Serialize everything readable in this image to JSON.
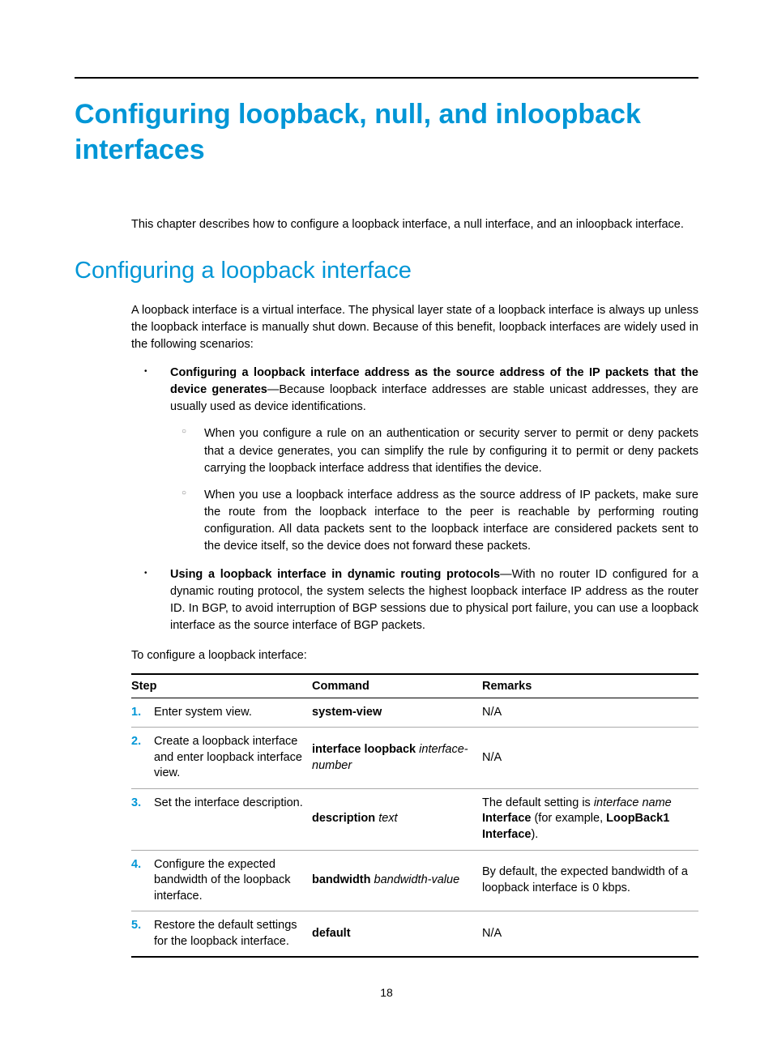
{
  "h1": "Configuring loopback, null, and inloopback interfaces",
  "intro": "This chapter describes how to configure a loopback interface, a null interface, and an inloopback interface.",
  "h2": "Configuring a loopback interface",
  "p1": "A loopback interface is a virtual interface. The physical layer state of a loopback interface is always up unless the loopback interface is manually shut down. Because of this benefit, loopback interfaces are widely used in the following scenarios:",
  "bullet1_lead": "Configuring a loopback interface address as the source address of the IP packets that the device generates",
  "bullet1_rest": "—Because loopback interface addresses are stable unicast addresses, they are usually used as device identifications.",
  "sub1": "When you configure a rule on an authentication or security server to permit or deny packets that a device generates, you can simplify the rule by configuring it to permit or deny packets carrying the loopback interface address that identifies the device.",
  "sub2": "When you use a loopback interface address as the source address of IP packets, make sure the route from the loopback interface to the peer is reachable by performing routing configuration. All data packets sent to the loopback interface are considered packets sent to the device itself, so the device does not forward these packets.",
  "bullet2_lead": "Using a loopback interface in dynamic routing protocols",
  "bullet2_rest": "—With no router ID configured for a dynamic routing protocol, the system selects the highest loopback interface IP address as the router ID. In BGP, to avoid interruption of BGP sessions due to physical port failure, you can use a loopback interface as the source interface of BGP packets.",
  "lead_in": "To configure a loopback interface:",
  "headers": {
    "step": "Step",
    "command": "Command",
    "remarks": "Remarks"
  },
  "rows": [
    {
      "num": "1.",
      "desc": "Enter system view.",
      "cmd_bold": "system-view",
      "cmd_italic": "",
      "rem_pre": "N/A",
      "rem_italic": "",
      "rem_bold1": "",
      "rem_mid": "",
      "rem_bold2": "",
      "rem_post": ""
    },
    {
      "num": "2.",
      "desc": "Create a loopback interface and enter loopback interface view.",
      "cmd_bold": "interface loopback",
      "cmd_italic": "interface-number",
      "rem_pre": "N/A",
      "rem_italic": "",
      "rem_bold1": "",
      "rem_mid": "",
      "rem_bold2": "",
      "rem_post": ""
    },
    {
      "num": "3.",
      "desc": "Set the interface description.",
      "cmd_bold": "description",
      "cmd_italic": "text",
      "rem_pre": "The default setting is ",
      "rem_italic": "interface name",
      "rem_bold1": "Interface",
      "rem_mid": " (for example, ",
      "rem_bold2": "LoopBack1 Interface",
      "rem_post": ")."
    },
    {
      "num": "4.",
      "desc": "Configure the expected bandwidth of the loopback interface.",
      "cmd_bold": "bandwidth",
      "cmd_italic": "bandwidth-value",
      "rem_pre": "By default, the expected bandwidth of a loopback interface is 0 kbps.",
      "rem_italic": "",
      "rem_bold1": "",
      "rem_mid": "",
      "rem_bold2": "",
      "rem_post": ""
    },
    {
      "num": "5.",
      "desc": "Restore the default settings for the loopback interface.",
      "cmd_bold": "default",
      "cmd_italic": "",
      "rem_pre": "N/A",
      "rem_italic": "",
      "rem_bold1": "",
      "rem_mid": "",
      "rem_bold2": "",
      "rem_post": ""
    }
  ],
  "page_num": "18"
}
